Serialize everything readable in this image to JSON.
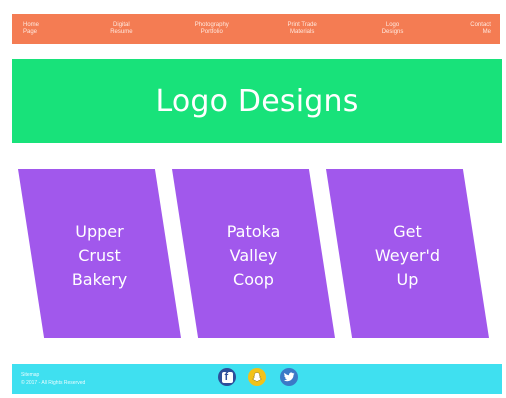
{
  "nav": {
    "items": [
      {
        "label": "Home\nPage"
      },
      {
        "label": "Digital\nResume"
      },
      {
        "label": "Photography\nPortfolio"
      },
      {
        "label": "Print Trade\nMaterials"
      },
      {
        "label": "Logo\nDesigns"
      },
      {
        "label": "Contact\nMe"
      }
    ]
  },
  "banner": {
    "title": "Logo Designs"
  },
  "cards": [
    {
      "label": "Upper\nCrust\nBakery"
    },
    {
      "label": "Patoka\nValley\nCoop"
    },
    {
      "label": "Get\nWeyer'd\nUp"
    }
  ],
  "footer": {
    "line1": "Sitemap",
    "line2": "© 2017 - All Rights Reserved",
    "social": [
      {
        "icon": "facebook-icon"
      },
      {
        "icon": "snapchat-icon"
      },
      {
        "icon": "twitter-icon"
      }
    ]
  },
  "colors": {
    "nav": "#f47c53",
    "banner": "#18e27a",
    "card": "#a158ec",
    "footer": "#3fe0f0"
  }
}
